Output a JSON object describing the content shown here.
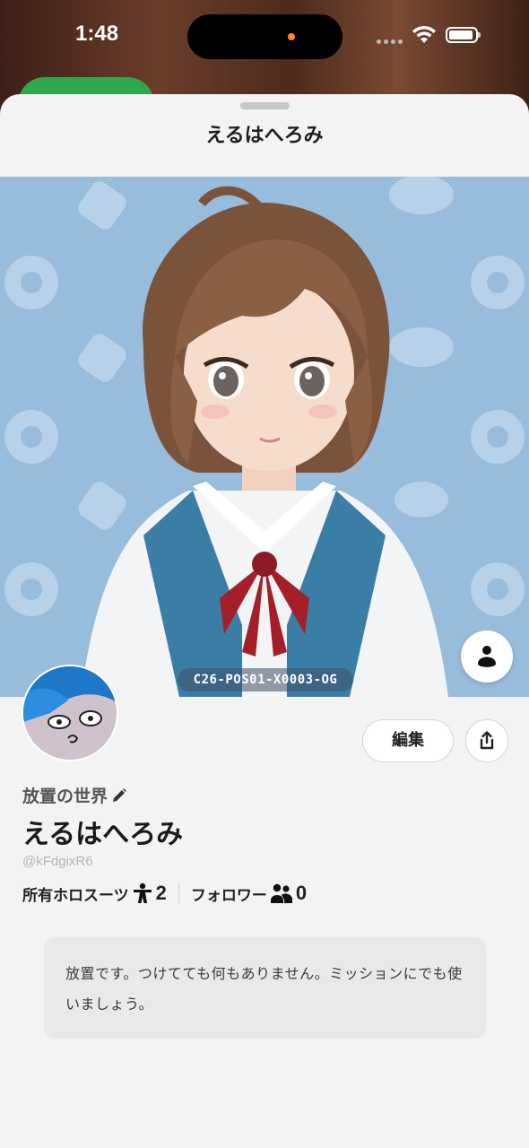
{
  "status_bar": {
    "time": "1:48"
  },
  "sheet": {
    "title": "えるはへろみ"
  },
  "hero": {
    "serial": "C26-POS01-X0003-OG"
  },
  "profile": {
    "world_name": "放置の世界",
    "display_name": "えるはへろみ",
    "handle": "@kFdgixR6",
    "edit_label": "編集",
    "stats": {
      "suits_label": "所有ホロスーツ",
      "suits_count": "2",
      "followers_label": "フォロワー",
      "followers_count": "0"
    },
    "bio": "放置です。つけてても何もありません。ミッションにでも使いましょう。"
  },
  "icons": [
    "wifi-icon",
    "battery-icon",
    "mannequin-icon",
    "share-icon",
    "pencil-icon",
    "person-icon",
    "followers-icon"
  ],
  "colors": {
    "hero_bg": "#98bcdb",
    "sheet_bg": "#f3f3f3",
    "bio_bg": "#e9e9e9"
  }
}
